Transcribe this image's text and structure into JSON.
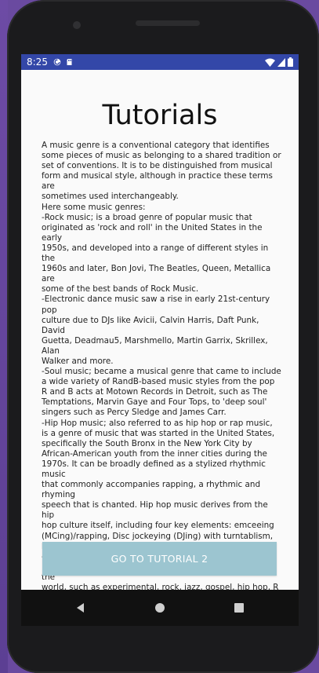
{
  "statusbar": {
    "time": "8:25",
    "left_icons": [
      "sync-icon",
      "sd-card-icon"
    ],
    "right_icons": [
      "wifi-icon",
      "signal-icon",
      "battery-icon"
    ],
    "color": "#3347a8"
  },
  "screen": {
    "title": "Tutorials",
    "body": "A music genre is a conventional category that identifies\nsome pieces of music as belonging to a shared tradition or\nset of conventions. It is to be distinguished from musical\nform and musical style, although in practice these terms are\nsometimes used interchangeably.\nHere some music genres:\n-Rock music; is a broad genre of popular music that\noriginated as 'rock and roll' in the United States in the early\n1950s, and developed into a range of different styles in the\n1960s and later, Bon Jovi, The Beatles, Queen, Metallica are\nsome of the best bands of Rock Music.\n-Electronic dance music saw a rise in early 21st-century pop\nculture due to DJs like Avicii, Calvin Harris, Daft Punk, David\nGuetta, Deadmau5, Marshmello, Martin Garrix, Skrillex, Alan\nWalker and more.\n-Soul music; became a musical genre that came to include\na wide variety of RandB-based music styles from the pop\nR and B acts at Motown Records in Detroit, such as The\nTemptations, Marvin Gaye and Four Tops, to 'deep soul'\nsingers such as Percy Sledge and James Carr.\n-Hip Hop music; also referred to as hip hop or rap music,\nis a genre of music that was started in the United States,\nspecifically the South Bronx in the New York City by\nAfrican-American youth from the inner cities during the\n1970s. It can be broadly defined as a stylized rhythmic music\nthat commonly accompanies rapping, a rhythmic and rhyming\nspeech that is chanted. Hip hop music derives from the hip\nhop culture itself, including four key elements: emceeing\n(MCing)/rapping, Disc jockeying (DJing) with turntablism,\nbreakdancing and graffiti art.\n-K-pop; is a genre of popular music originating in South\nKorea. It is influenced by styles and genres from around the\nworld, such as experimental, rock, jazz, gospel, hip hop, R and\nB, reggae, electronic dance, folk, country, and classical on top\nof its traditional Korean music roots.\n-Country music; also known as country and western (or\nsimply country) and hillbilly music, is a genre of popular music\nthat originated in the southern United States in the early\n1920s.\n-The polka is originally a Czech dance and genre of dance\nmusic familiar throughout Europe and the Americas.",
    "button_label": "GO TO TUTORIAL 2",
    "button_color": "#9cc5d0"
  },
  "navbar": {
    "buttons": [
      "back-icon",
      "home-icon",
      "recents-icon"
    ]
  }
}
